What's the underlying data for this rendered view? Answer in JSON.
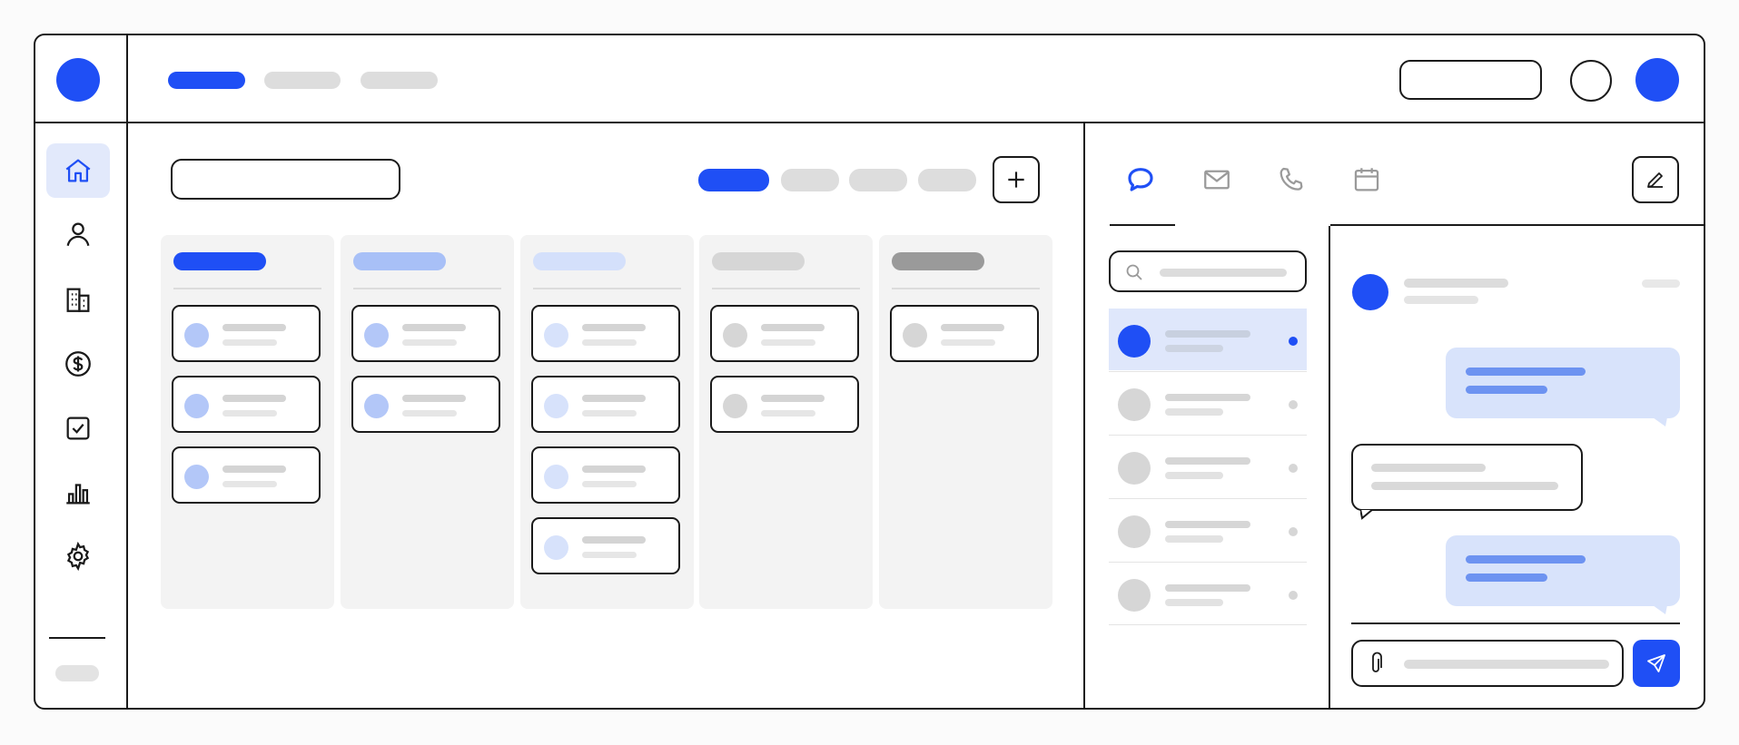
{
  "colors": {
    "accent": "#1f4ff5",
    "accent_light": "#a8c0f7",
    "accent_lighter": "#d8e3fb",
    "placeholder_gray": "#d9d9d9",
    "dark_gray": "#9a9a9a",
    "border": "#1a1a1a"
  },
  "header": {
    "nav_pills": [
      {
        "state": "active"
      },
      {
        "state": "inactive"
      },
      {
        "state": "inactive"
      }
    ],
    "icons": [
      "logo-icon",
      "notification-circle-icon",
      "user-avatar-icon"
    ]
  },
  "sidebar": {
    "items": [
      {
        "icon": "home-icon",
        "active": true
      },
      {
        "icon": "user-icon",
        "active": false
      },
      {
        "icon": "building-icon",
        "active": false
      },
      {
        "icon": "dollar-icon",
        "active": false
      },
      {
        "icon": "checkbox-icon",
        "active": false
      },
      {
        "icon": "bar-chart-icon",
        "active": false
      },
      {
        "icon": "settings-gear-icon",
        "active": false
      }
    ]
  },
  "board": {
    "filter_pills": [
      {
        "state": "active"
      },
      {
        "state": "inactive"
      },
      {
        "state": "inactive"
      },
      {
        "state": "inactive"
      }
    ],
    "add_icon": "plus-icon",
    "columns": [
      {
        "header_color": "#1f4ff5",
        "card_avatar_color": "#b3c7f8",
        "cards": 3
      },
      {
        "header_color": "#a8c0f7",
        "card_avatar_color": "#b3c7f8",
        "cards": 2
      },
      {
        "header_color": "#d4e0fb",
        "card_avatar_color": "#d7e2fb",
        "cards": 4
      },
      {
        "header_color": "#d6d6d6",
        "card_avatar_color": "#d6d6d6",
        "cards": 2
      },
      {
        "header_color": "#9a9a9a",
        "card_avatar_color": "#d6d6d6",
        "cards": 1
      }
    ]
  },
  "messaging": {
    "tabs": [
      {
        "icon": "chat-bubble-icon",
        "active": true
      },
      {
        "icon": "mail-icon",
        "active": false
      },
      {
        "icon": "phone-icon",
        "active": false
      },
      {
        "icon": "calendar-icon",
        "active": false
      }
    ],
    "compose_icon": "pencil-edit-icon",
    "search_icon": "search-icon",
    "conversations": [
      {
        "active": true,
        "unread": true
      },
      {
        "active": false,
        "unread": false
      },
      {
        "active": false,
        "unread": false
      },
      {
        "active": false,
        "unread": false
      },
      {
        "active": false,
        "unread": false
      }
    ],
    "attach_icon": "paperclip-icon",
    "send_icon": "send-icon"
  }
}
